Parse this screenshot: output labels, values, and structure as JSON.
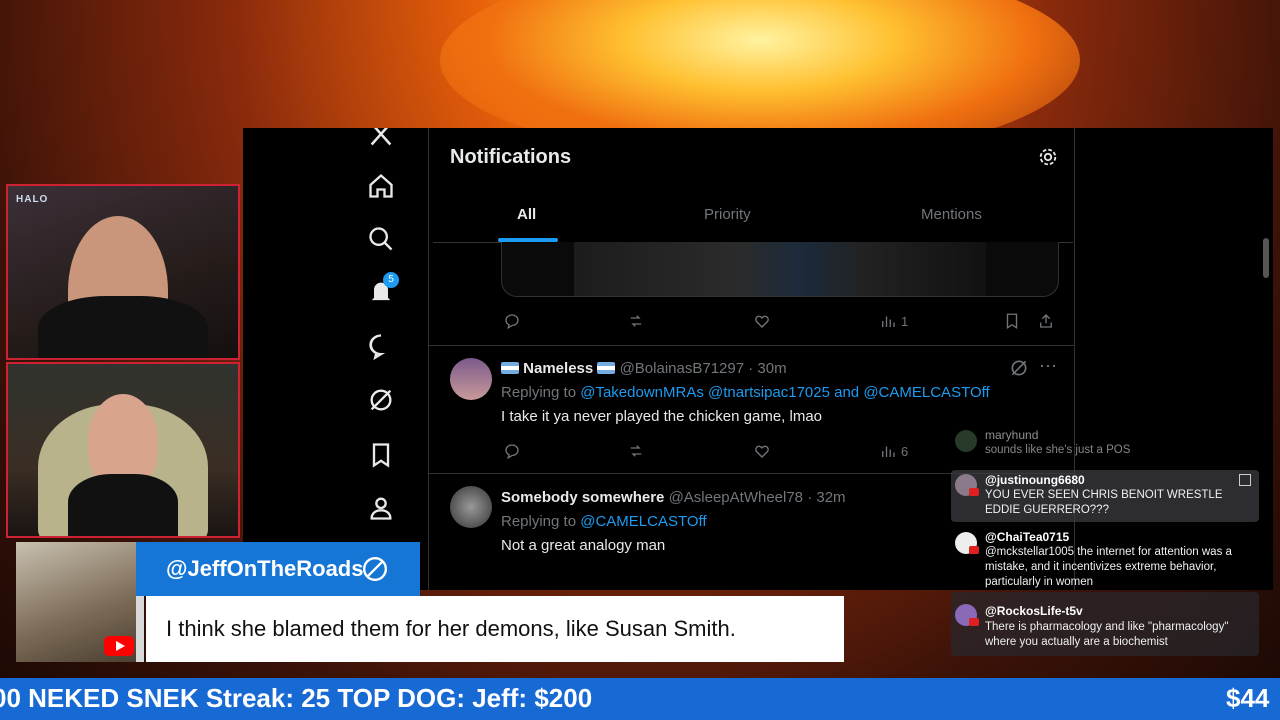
{
  "twitter": {
    "header_title": "Notifications",
    "notification_badge": "5",
    "tabs": [
      {
        "label": "All"
      },
      {
        "label": "Priority"
      },
      {
        "label": "Mentions"
      }
    ],
    "first_post_views": "1",
    "posts": [
      {
        "name": "Nameless",
        "handle_time": "@BolainasB71297 · 30m",
        "replying_prefix": "Replying to ",
        "replying_to": "@TakedownMRAs @tnartsipac17025 and @CAMELCASTOff",
        "text": "I take it ya never played the chicken game, lmao",
        "views": "6"
      },
      {
        "name": "Somebody somewhere",
        "handle_time": "@AsleepAtWheel78 · 32m",
        "replying_prefix": "Replying to ",
        "replying_to": "@CAMELCASTOff",
        "text": "Not a great analogy man"
      }
    ]
  },
  "chat": {
    "messages": [
      {
        "name": "maryhund",
        "text": "sounds like she's just a POS"
      },
      {
        "name": "@justinoung6680",
        "text": "YOU EVER SEEN CHRIS BENOIT WRESTLE EDDIE GUERRERO???"
      },
      {
        "name": "@ChaiTea0715",
        "text": "@mckstellar1005 the internet for attention was a mistake, and it incentivizes extreme behavior, particularly in women"
      },
      {
        "name": "@RockosLife-t5v",
        "text": "There is pharmacology and like \"pharmacology\" where you actually are a biochemist"
      }
    ]
  },
  "lower_third": {
    "handle": "@JeffOnTheRoads",
    "quote": "I think she blamed them for her demons, like Susan Smith."
  },
  "ticker": {
    "text": "00 NEKED SNEK Streak: 25 TOP DOG: Jeff: $200",
    "right_text": "$44"
  },
  "colors": {
    "accent_blue": "#1d9bf0",
    "ticker_blue": "#1769d4",
    "handle_blue": "#1576d6"
  }
}
